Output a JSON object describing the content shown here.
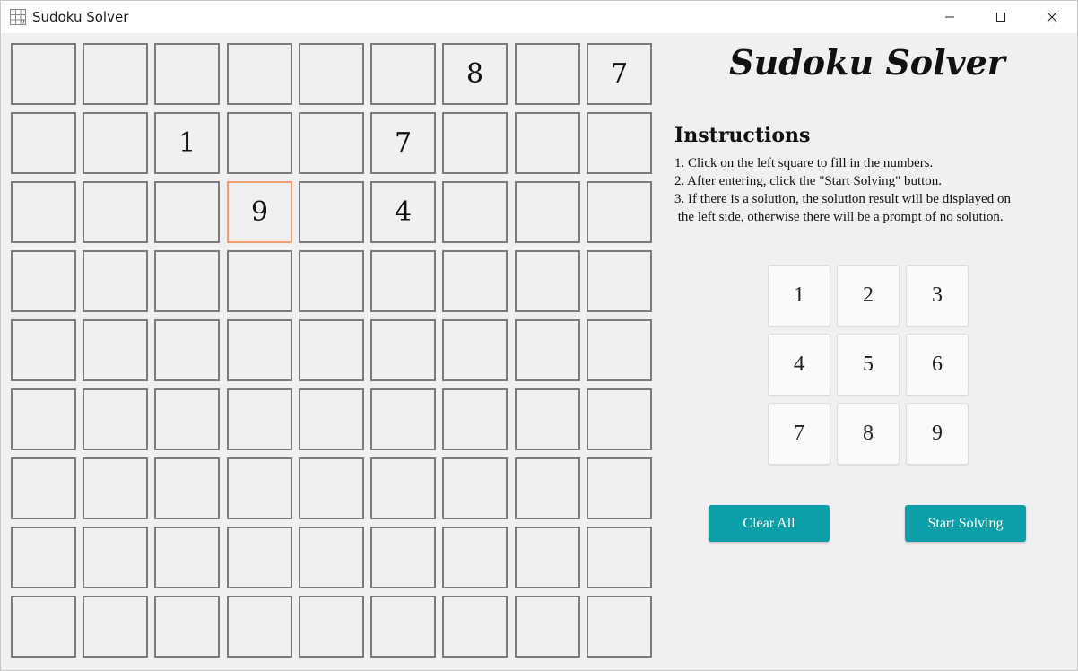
{
  "window": {
    "title": "Sudoku Solver",
    "icon": "sudoku-grid-icon",
    "controls": [
      "minimize-icon",
      "maximize-icon",
      "close-icon"
    ]
  },
  "board": {
    "rows": [
      [
        "",
        "",
        "",
        "",
        "",
        "",
        "8",
        "",
        "7"
      ],
      [
        "",
        "",
        "1",
        "",
        "",
        "7",
        "",
        "",
        ""
      ],
      [
        "",
        "",
        "",
        "9",
        "",
        "4",
        "",
        "",
        ""
      ],
      [
        "",
        "",
        "",
        "",
        "",
        "",
        "",
        "",
        ""
      ],
      [
        "",
        "",
        "",
        "",
        "",
        "",
        "",
        "",
        ""
      ],
      [
        "",
        "",
        "",
        "",
        "",
        "",
        "",
        "",
        ""
      ],
      [
        "",
        "",
        "",
        "",
        "",
        "",
        "",
        "",
        ""
      ],
      [
        "",
        "",
        "",
        "",
        "",
        "",
        "",
        "",
        ""
      ],
      [
        "",
        "",
        "",
        "",
        "",
        "",
        "",
        "",
        ""
      ]
    ],
    "selected_cell": [
      2,
      3
    ],
    "selected_color": "#f2a070"
  },
  "panel": {
    "title": "Sudoku Solver",
    "instructions_heading": "Instructions",
    "instructions": [
      "1. Click on the left square to fill in the numbers.",
      "2. After entering, click the \"Start Solving\" button.",
      "3. If there is a solution, the solution result will be displayed on",
      " the left side, otherwise there will be a prompt of no solution."
    ],
    "numpad": [
      "1",
      "2",
      "3",
      "4",
      "5",
      "6",
      "7",
      "8",
      "9"
    ],
    "clear_label": "Clear All",
    "solve_label": "Start Solving",
    "accent_color": "#0c9fa8"
  }
}
